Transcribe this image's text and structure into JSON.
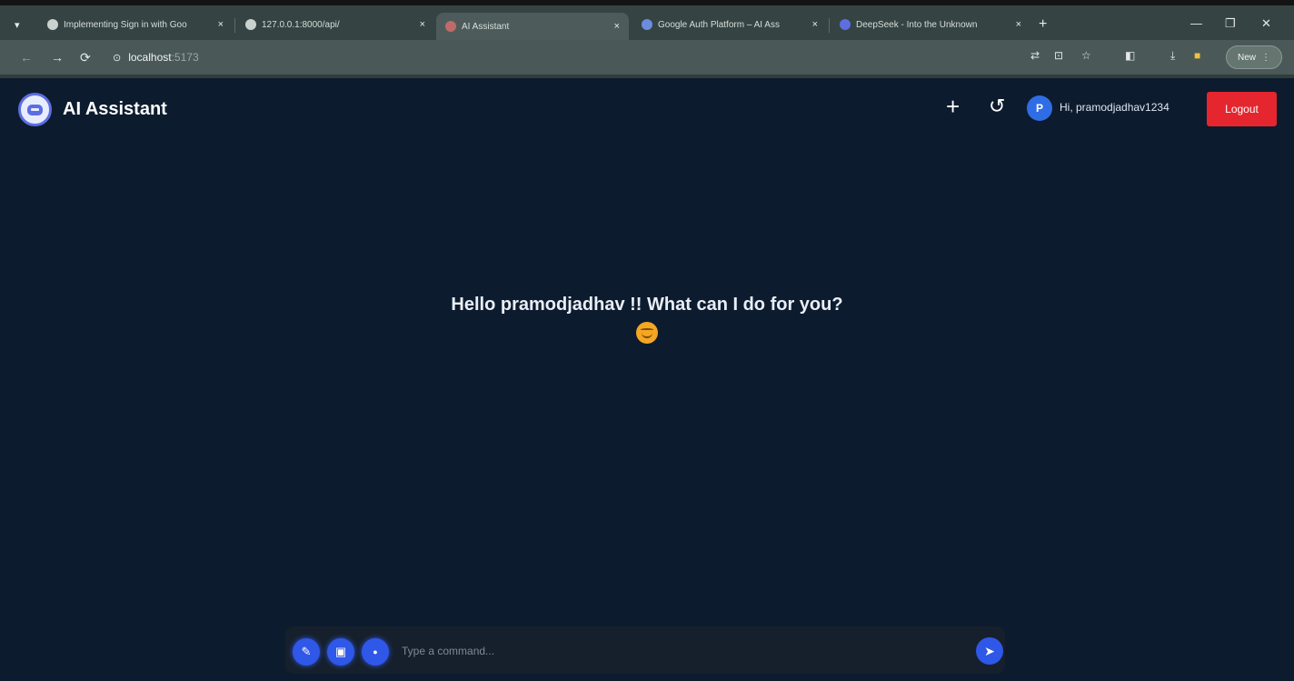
{
  "browser": {
    "tabs": [
      {
        "title": "Implementing Sign in with Goo",
        "fav_color": "#c9d2cf",
        "active": false
      },
      {
        "title": "127.0.0.1:8000/api/",
        "fav_color": "#c9d2cf",
        "active": false
      },
      {
        "title": "AI Assistant",
        "fav_color": "#c06a6a",
        "active": true
      },
      {
        "title": "Google Auth Platform – AI Ass",
        "fav_color": "#6c8ce0",
        "active": false
      },
      {
        "title": "DeepSeek - Into the Unknown",
        "fav_color": "#5d6fe0",
        "active": false
      }
    ],
    "tab_close": "×",
    "new_tab": "+",
    "window_controls": {
      "minimize": "—",
      "maximize": "❐",
      "close": "✕"
    },
    "nav": {
      "back": "←",
      "forward": "→",
      "reload": "⟳"
    },
    "address": {
      "host": "localhost",
      "port": ":5173"
    },
    "profile_label": "New"
  },
  "app": {
    "brand": "AI Assistant",
    "new_chat_icon": "+",
    "history_icon": "↺",
    "avatar_letter": "P",
    "greeting": "Hi, pramodjadhav1234",
    "logout_label": "Logout",
    "welcome": "Hello pramodjadhav !! What can I do for you?",
    "composer": {
      "attach_icon": "✎",
      "image_icon": "▣",
      "mic_icon": "●",
      "placeholder": "Type a command...",
      "send_icon": "➤"
    }
  }
}
